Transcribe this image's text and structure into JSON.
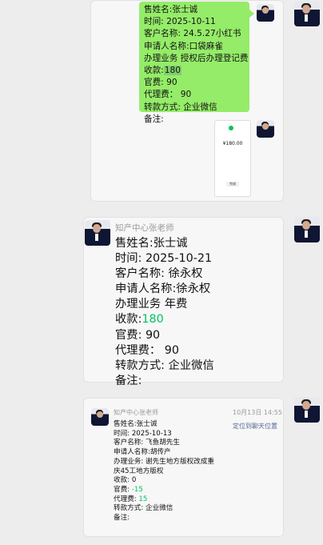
{
  "msg1": {
    "lines": [
      "售姓名:张士诚",
      "时间:  2025-10-11",
      "客户名称:  24.5.27小红书",
      "申请人名称:口袋麻雀",
      "办理业务 授权后办理登记费",
      "收款:",
      "180",
      "官费:  90",
      "代理费：  90",
      "转款方式:  企业微信",
      "备注:"
    ],
    "phone_amount": "¥180.00",
    "phone_button": "完成"
  },
  "msg2": {
    "sender": "知产中心张老师",
    "lines": [
      "售姓名:张士诚",
      "时间:  2025-10-21",
      "客户名称:  徐永权",
      "申请人名称:徐永权",
      "办理业务 年费",
      "收款:",
      "180",
      "官费:  90",
      "代理费：  90",
      "转款方式:  企业微信",
      "备注:"
    ]
  },
  "msg3": {
    "sender": "知产中心张老师",
    "time": "10月13日 14:55",
    "locate": "定位到聊天位置",
    "lines": [
      "售姓名:张士诚",
      "时间:  2025-10-13",
      "客户名称:  飞鱼胡先生",
      "申请人名称:胡传产",
      "办理业务:  谢先生地方版权改成重",
      "庆45工地方版权",
      "收款:  0",
      "官费:",
      "-15",
      "代理费:",
      "15",
      "转款方式:  企业微信",
      "备注:"
    ]
  },
  "colors": {
    "bubble_green": "#95ec69",
    "money_green": "#07c160",
    "background": "#ededed"
  }
}
